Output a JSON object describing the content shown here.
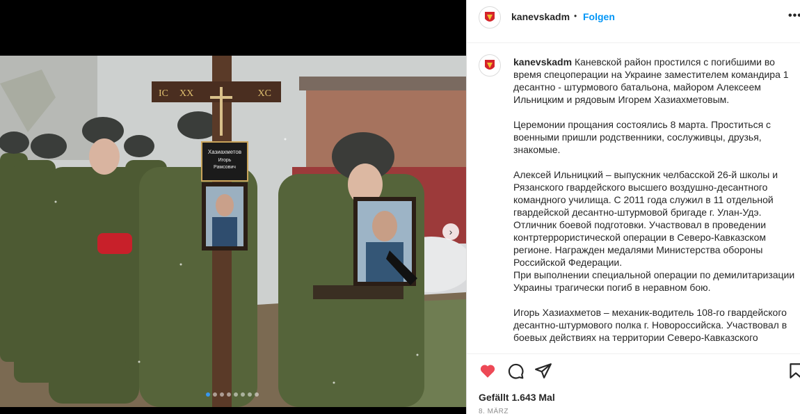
{
  "post": {
    "username": "kanevskadm",
    "separator": "•",
    "follow_label": "Folgen",
    "more_label": "•••",
    "caption_user": "kanevskadm",
    "caption_body": " Каневской район простился с погибшими во время спецоперации на Украине заместителем командира 1\nдесантно - штурмового батальона, майором Алексеем Ильницким и рядовым Игорем Хазиахметовым.\n\nЦеремонии прощания состоялись 8 марта. Проститься с военными пришли родственники, сослуживцы, друзья, знакомые.\n\nАлексей Ильницкий – выпускник челбасской 26-й школы и Рязанского гвардейского высшего воздушно-десантного командного училища. С 2011 года служил в 11 отдельной гвардейской десантно-штурмовой бригаде г. Улан-Удэ. Отличник боевой подготовки. Участвовал в проведении контртеррористической операции в Северо-Кавказском регионе. Награжден медалями Министерства обороны Российской Федерации.\nПри выполнении специальной операции по демилитаризации Украины трагически погиб в неравном бою.\n\nИгорь Хазиахметов – механик-водитель 108-го гвардейского десантно-штурмового полка г. Новороссийска. Участвовал в боевых действиях на территории Северо-Кавказского",
    "likes_text": "Gefällt 1.643 Mal",
    "date_text": "8. MÄRZ"
  },
  "photo": {
    "cross_text_left": "IC",
    "cross_text_mid": "XX",
    "cross_text_right": "XC",
    "plaque_name": "Хазиахметов",
    "plaque_first": "Игорь",
    "plaque_patronymic": "Рамсович",
    "carousel_count": 8,
    "carousel_active": 0
  },
  "icons": {
    "like": "heart-icon",
    "comment": "comment-icon",
    "share": "share-icon",
    "save": "bookmark-icon",
    "next": "chevron-right-icon"
  },
  "colors": {
    "accent": "#0095f6",
    "like": "#ed4956",
    "active_dot": "#3797f0"
  }
}
